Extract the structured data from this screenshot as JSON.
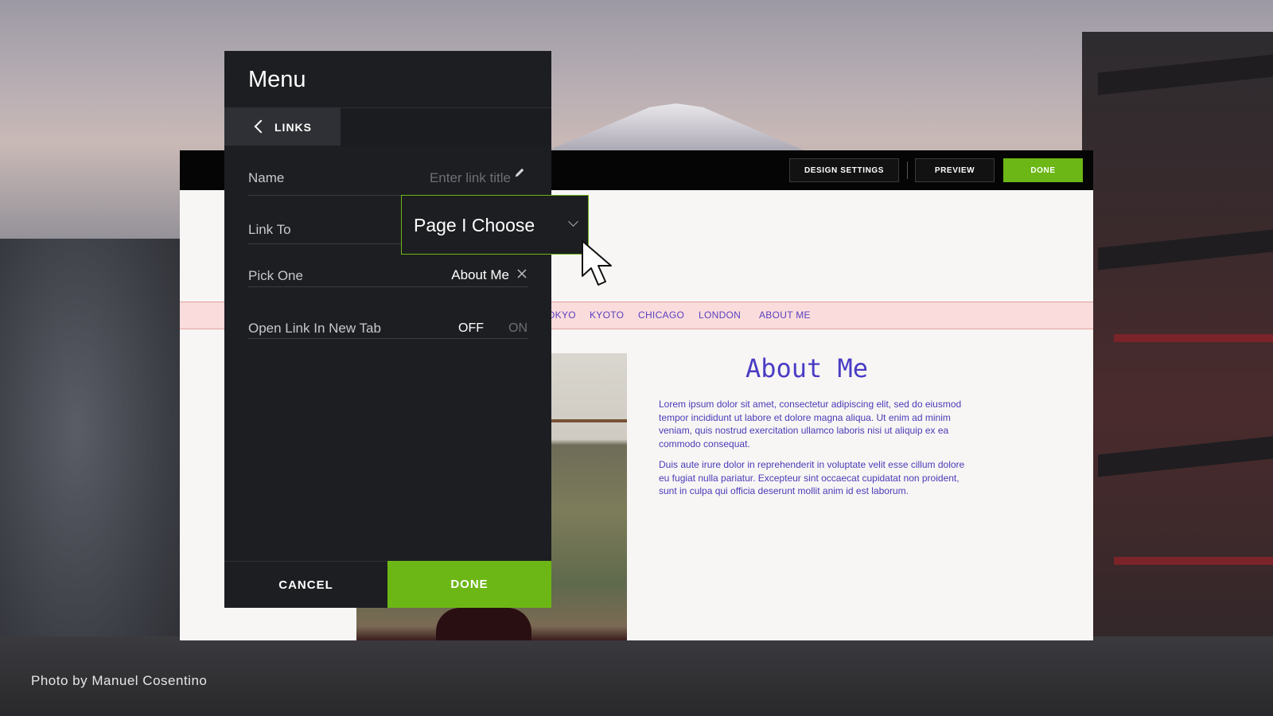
{
  "editor": {
    "topbar": {
      "design_settings_label": "DESIGN SETTINGS",
      "preview_label": "PREVIEW",
      "done_label": "DONE"
    },
    "nav": {
      "items": [
        "OKYO",
        "KYOTO",
        "CHICAGO",
        "LONDON",
        "ABOUT ME"
      ]
    },
    "about": {
      "title": "About Me",
      "paragraph_1": "Lorem ipsum dolor sit amet, consectetur adipiscing elit, sed do eiusmod tempor incididunt ut labore et dolore magna aliqua. Ut enim ad minim veniam, quis nostrud exercitation ullamco laboris nisi ut aliquip ex ea commodo consequat.",
      "paragraph_2": "Duis aute irure dolor in reprehenderit in voluptate velit esse cillum dolore eu fugiat nulla pariatur. Excepteur sint occaecat cupidatat non proident, sunt in culpa qui officia deserunt mollit anim id est laborum."
    }
  },
  "menu": {
    "title": "Menu",
    "back_tab_label": "LINKS",
    "fields": {
      "name": {
        "label": "Name",
        "value": "",
        "placeholder": "Enter link title"
      },
      "link_to": {
        "label": "Link To",
        "selected": "Page I Choose"
      },
      "pick_one": {
        "label": "Pick One",
        "value": "About Me"
      },
      "new_tab": {
        "label": "Open Link In New Tab",
        "off_label": "OFF",
        "on_label": "ON",
        "state": "OFF"
      }
    },
    "footer": {
      "cancel_label": "CANCEL",
      "done_label": "DONE"
    }
  },
  "photo_credit": "Photo by Manuel Cosentino",
  "colors": {
    "accent_green": "#6cb716",
    "panel_dark": "#1d1e22",
    "site_link_purple": "#5a3fc0",
    "nav_bar_pink": "#fadcdc"
  },
  "icons": [
    "chevron-left-icon",
    "pencil-icon",
    "chevron-down-icon",
    "close-icon",
    "mouse-cursor-icon"
  ]
}
